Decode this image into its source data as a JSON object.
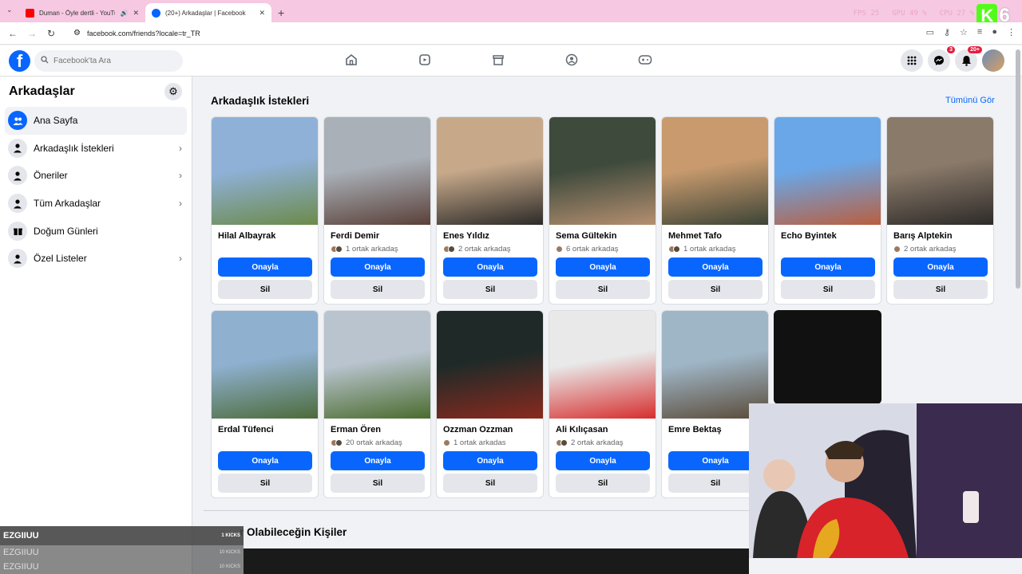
{
  "browser": {
    "tabs": [
      {
        "title": "Duman - Öyle dertli - YouTube",
        "icon_color": "#ff0000",
        "active": false
      },
      {
        "title": "(20+) Arkadaşlar | Facebook",
        "icon_color": "#0866ff",
        "active": true
      }
    ],
    "new_tab": "+",
    "url": "facebook.com/friends?locale=tr_TR",
    "stats": {
      "fps_label": "FPS",
      "fps": "25",
      "gpu_label": "GPU",
      "gpu": "49 %",
      "cpu_label": "CPU",
      "cpu": "27 %"
    },
    "overlay_logo": {
      "letter": "K",
      "number": "6"
    }
  },
  "header": {
    "search_placeholder": "Facebook'ta Ara",
    "messenger_badge": "3",
    "notifications_badge": "20+"
  },
  "sidebar": {
    "title": "Arkadaşlar",
    "items": [
      {
        "label": "Ana Sayfa",
        "icon": "people-icon",
        "active": true,
        "chevron": false
      },
      {
        "label": "Arkadaşlık İstekleri",
        "icon": "person-add-icon",
        "active": false,
        "chevron": true
      },
      {
        "label": "Öneriler",
        "icon": "person-plus-icon",
        "active": false,
        "chevron": true
      },
      {
        "label": "Tüm Arkadaşlar",
        "icon": "person-list-icon",
        "active": false,
        "chevron": true
      },
      {
        "label": "Doğum Günleri",
        "icon": "gift-icon",
        "active": false,
        "chevron": false
      },
      {
        "label": "Özel Listeler",
        "icon": "person-list-icon",
        "active": false,
        "chevron": true
      }
    ]
  },
  "main": {
    "title": "Arkadaşlık İstekleri",
    "see_all": "Tümünü Gör",
    "confirm_label": "Onayla",
    "delete_label": "Sil",
    "requests": [
      {
        "name": "Hilal Albayrak",
        "mutual": "",
        "photo": [
          "#8fb1d8",
          "#6c8a4a"
        ]
      },
      {
        "name": "Ferdi Demir",
        "mutual": "1 ortak arkadaş",
        "photo": [
          "#a9b0b8",
          "#5a4038"
        ]
      },
      {
        "name": "Enes Yıldız",
        "mutual": "2 ortak arkadaş",
        "photo": [
          "#c7a98a",
          "#2c2a28"
        ]
      },
      {
        "name": "Sema Gültekin",
        "mutual": "6 ortak arkadaş",
        "photo": [
          "#3e4a3c",
          "#b58f70"
        ]
      },
      {
        "name": "Mehmet Tafo",
        "mutual": "1 ortak arkadaş",
        "photo": [
          "#c89a6e",
          "#3c4436"
        ]
      },
      {
        "name": "Echo Byintek",
        "mutual": "",
        "photo": [
          "#6aa7e8",
          "#b95f3f"
        ]
      },
      {
        "name": "Barış Alptekin",
        "mutual": "2 ortak arkadaş",
        "photo": [
          "#8a7a6a",
          "#2d2a28"
        ]
      },
      {
        "name": "Erdal Tüfenci",
        "mutual": "",
        "photo": [
          "#8fb0cf",
          "#4c6b3a"
        ]
      },
      {
        "name": "Erman Ören",
        "mutual": "20 ortak arkadaş",
        "photo": [
          "#b9c4cf",
          "#4a6b2d"
        ]
      },
      {
        "name": "Ozzman Ozzman",
        "mutual": "1 ortak arkadas",
        "photo": [
          "#1f2a28",
          "#8a2a1e"
        ]
      },
      {
        "name": "Ali Kılıçasan",
        "mutual": "2 ortak arkadaş",
        "photo": [
          "#e9e9e9",
          "#d62d2d"
        ]
      },
      {
        "name": "Emre Bektaş",
        "mutual": "",
        "photo": [
          "#9fb6c7",
          "#5a4a38"
        ]
      }
    ],
    "section2_title": "r Olabileceğin Kişiler"
  },
  "kick_overlay": [
    {
      "name": "EZGIIUU",
      "count": "1 KICKS"
    },
    {
      "name": "EZGIIUU",
      "count": "10 KICKS"
    },
    {
      "name": "EZGIIUU",
      "count": "10 KICKS"
    }
  ]
}
